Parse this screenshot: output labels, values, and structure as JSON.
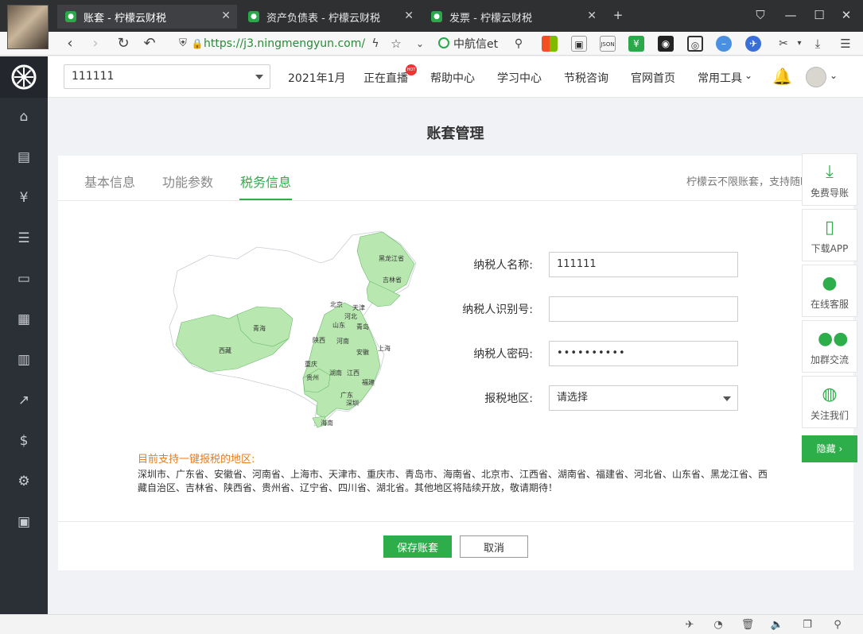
{
  "browser": {
    "tabs": [
      {
        "title": "账套 - 柠檬云财税",
        "active": true
      },
      {
        "title": "资产负债表 - 柠檬云财税",
        "active": false
      },
      {
        "title": "发票 - 柠檬云财税",
        "active": false
      }
    ],
    "url": "https://j3.ningmengyun.com/",
    "search_engine": "中航信et"
  },
  "header": {
    "company": "111111",
    "period": "2021年1月",
    "live": "正在直播",
    "hot_badge": "HOT",
    "help": "帮助中心",
    "learn": "学习中心",
    "tax_consult": "节税咨询",
    "official": "官网首页",
    "tools": "常用工具"
  },
  "page": {
    "title": "账套管理",
    "tabs": [
      "基本信息",
      "功能参数",
      "税务信息"
    ],
    "active_tab": "税务信息",
    "note": "柠檬云不限账套，支持随时修改账套"
  },
  "form": {
    "taxpayer_name_label": "纳税人名称:",
    "taxpayer_name": "111111",
    "taxpayer_id_label": "纳税人识别号:",
    "taxpayer_id": "",
    "taxpayer_pwd_label": "纳税人密码:",
    "taxpayer_pwd": "••••••••••",
    "region_label": "报税地区:",
    "region": "请选择"
  },
  "map": {
    "labels": [
      "黑龙江省",
      "吉林省",
      "北京",
      "天津",
      "河北",
      "山东",
      "青岛",
      "陕西",
      "河南",
      "安徽",
      "上海",
      "重庆",
      "湖南",
      "江西",
      "贵州",
      "福建",
      "广东",
      "深圳",
      "海南",
      "青海",
      "西藏"
    ]
  },
  "support": {
    "title": "目前支持一键报税的地区:",
    "text": "深圳市、广东省、安徽省、河南省、上海市、天津市、重庆市、青岛市、海南省、北京市、江西省、湖南省、福建省、河北省、山东省、黑龙江省、西藏自治区、吉林省、陕西省、贵州省、辽宁省、四川省、湖北省。其他地区将陆续开放，敬请期待！"
  },
  "buttons": {
    "save": "保存账套",
    "cancel": "取消"
  },
  "float": {
    "free_nav": "免费导账",
    "download": "下载APP",
    "online": "在线客服",
    "group": "加群交流",
    "follow": "关注我们",
    "hide": "隐藏"
  },
  "colors": {
    "accent": "#2eae4a",
    "sidebar": "#2b2f36",
    "orange": "#e87d1e"
  }
}
